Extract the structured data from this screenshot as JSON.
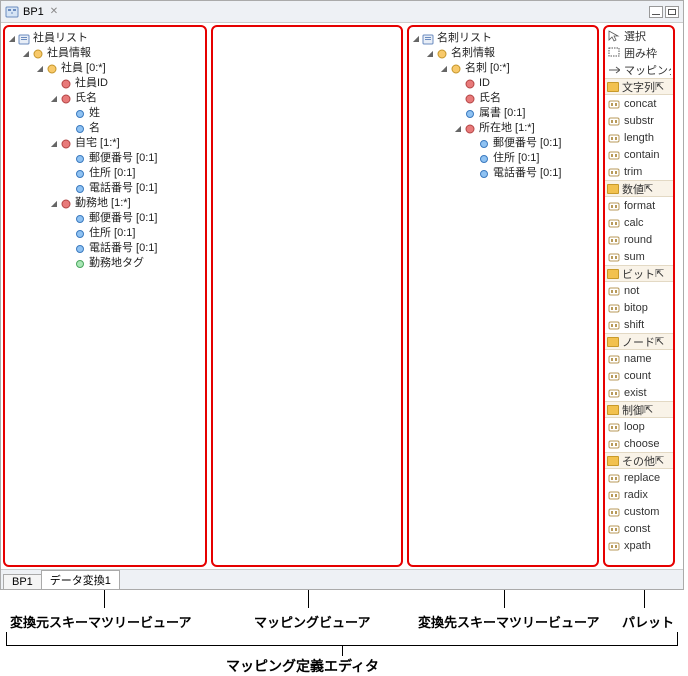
{
  "titlebar": {
    "title": "BP1"
  },
  "tabs": {
    "tab1": "BP1",
    "tab2": "データ変換1"
  },
  "src_tree": {
    "root": "社員リスト",
    "n1": "社員情報",
    "n2": "社員 [0:*]",
    "n3": "社員ID",
    "n4": "氏名",
    "n5": "姓",
    "n6": "名",
    "n7": "自宅 [1:*]",
    "n8": "郵便番号 [0:1]",
    "n9": "住所 [0:1]",
    "n10": "電話番号 [0:1]",
    "n11": "勤務地 [1:*]",
    "n12": "郵便番号 [0:1]",
    "n13": "住所 [0:1]",
    "n14": "電話番号 [0:1]",
    "n15": "勤務地タグ"
  },
  "dst_tree": {
    "root": "名刺リスト",
    "n1": "名刺情報",
    "n2": "名刺 [0:*]",
    "n3": "ID",
    "n4": "氏名",
    "n5": "属書 [0:1]",
    "n6": "所在地 [1:*]",
    "n7": "郵便番号 [0:1]",
    "n8": "住所 [0:1]",
    "n9": "電話番号 [0:1]"
  },
  "palette": {
    "tool_select": "選択",
    "tool_frame": "囲み枠",
    "tool_mapping": "マッピング",
    "cat_string": "文字列",
    "concat": "concat",
    "substr": "substr",
    "length": "length",
    "contain": "contain",
    "trim": "trim",
    "cat_number": "数値",
    "format": "format",
    "calc": "calc",
    "round": "round",
    "sum": "sum",
    "cat_bit": "ビット",
    "not": "not",
    "bitop": "bitop",
    "shift": "shift",
    "cat_node": "ノード",
    "name": "name",
    "count": "count",
    "exist": "exist",
    "cat_control": "制御",
    "loop": "loop",
    "choose": "choose",
    "cat_other": "その他",
    "replace": "replace",
    "radix": "radix",
    "custom": "custom",
    "const": "const",
    "xpath": "xpath"
  },
  "annotations": {
    "src": "変換元スキーマツリービューア",
    "mid": "マッピングビューア",
    "dst": "変換先スキーマツリービューア",
    "pal": "パレット",
    "main": "マッピング定義エディタ"
  }
}
